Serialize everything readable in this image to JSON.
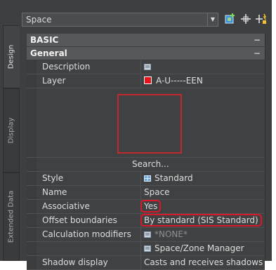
{
  "tabs": [
    {
      "label": "Design"
    },
    {
      "label": "Display"
    },
    {
      "label": "Extended Data"
    }
  ],
  "toolbar": {
    "style_value": "Space",
    "icons": [
      "add-properties-icon",
      "pick-point-icon",
      "quick-select-icon"
    ]
  },
  "categories": {
    "basic": {
      "label": "BASIC",
      "collapse": "−"
    },
    "general": {
      "label": "General",
      "collapse": "−"
    }
  },
  "properties": {
    "description": {
      "name": "Description",
      "value_icon": "description-editor-icon"
    },
    "layer": {
      "name": "Layer",
      "value": "A-U-----EEN",
      "color": "#e8141c"
    },
    "search": {
      "label": "Search..."
    },
    "style": {
      "name": "Style",
      "value": "Standard",
      "value_icon": "style-icon"
    },
    "space_name": {
      "name": "Name",
      "value": "Space"
    },
    "associative": {
      "name": "Associative",
      "value": "Yes"
    },
    "offset_boundaries": {
      "name": "Offset boundaries",
      "value": "By standard (SIS Standard)"
    },
    "calculation_modifiers": {
      "name": "Calculation modifiers",
      "value": "*NONE*",
      "value_icon": "list-icon"
    },
    "zone_manager": {
      "value": "Space/Zone Manager",
      "value_icon": "list-icon"
    },
    "shadow_display": {
      "name": "Shadow display",
      "value": "Casts and receives shadows"
    }
  },
  "colors": {
    "panel_bg": "#3d3f41",
    "highlight": "#d7192a",
    "layer_swatch": "#e8141c"
  }
}
